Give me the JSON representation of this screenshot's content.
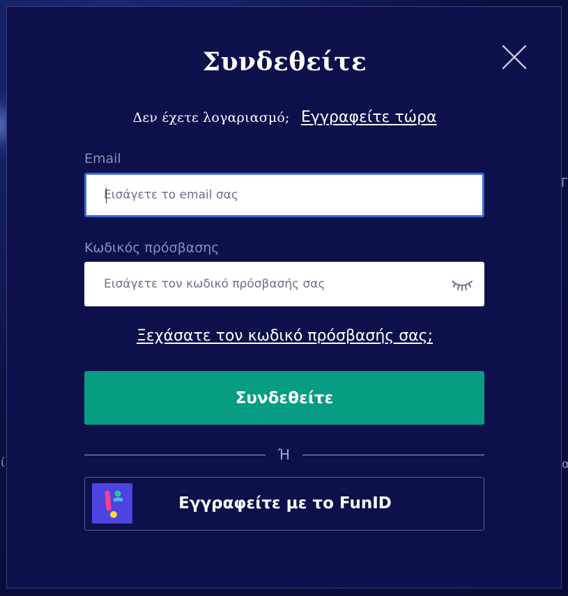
{
  "modal": {
    "title": "Συνδεθείτε",
    "signup_prompt": "Δεν έχετε λογαριασμό;",
    "signup_link": "Εγγραφείτε τώρα",
    "email_label": "Email",
    "email_placeholder": "Εισάγετε το email σας",
    "password_label": "Κωδικός πρόσβασης",
    "password_placeholder": "Εισάγετε τον κωδικό πρόσβασής σας",
    "forgot_link": "Ξεχάσατε τον κωδικό πρόσβασής σας;",
    "login_button": "Συνδεθείτε",
    "divider_text": "Ή",
    "funid_button": "Εγγραφείτε με το FunID"
  },
  "icons": {
    "close": "close-icon",
    "password_visibility": "eye-closed-icon",
    "funid_logo": "funid-logo-icon"
  },
  "colors": {
    "modal_bg": "#0d104a",
    "primary_button": "#079d83",
    "input_focus": "#3f67d8",
    "label_text": "#8b90b8"
  }
}
